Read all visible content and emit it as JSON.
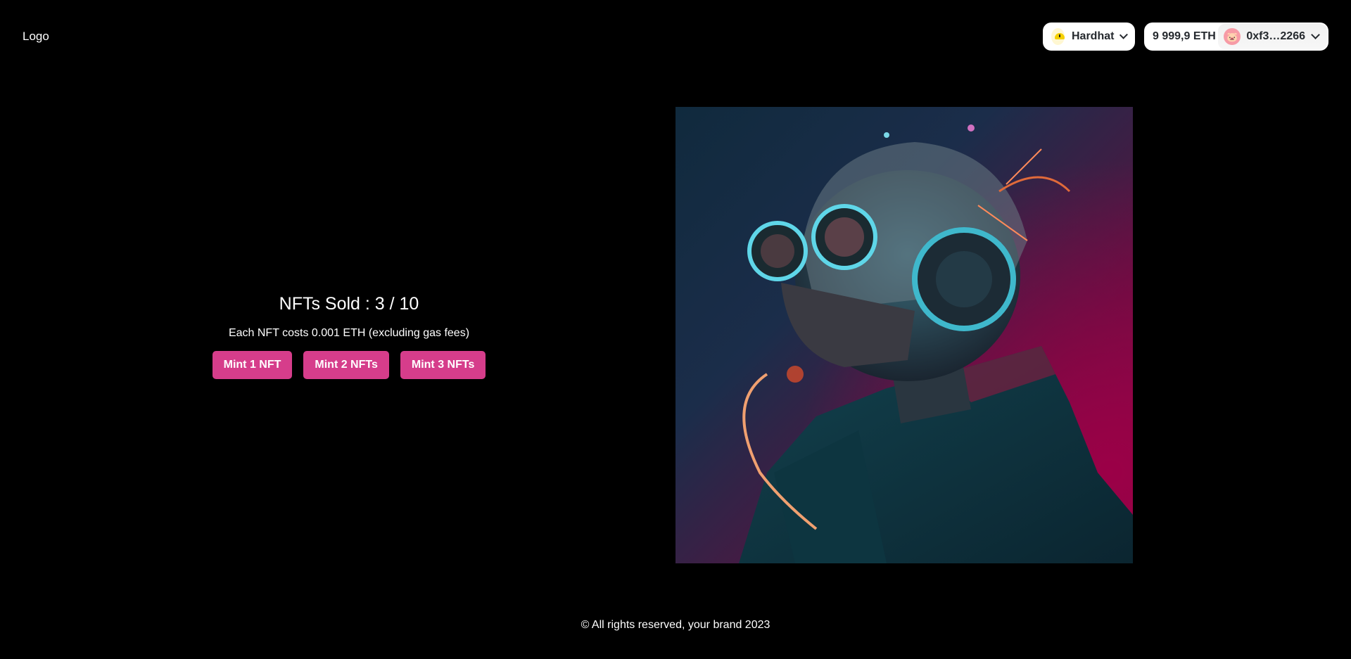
{
  "header": {
    "logo": "Logo",
    "chain": {
      "name": "Hardhat",
      "icon": "hardhat-icon"
    },
    "account": {
      "balance": "9 999,9 ETH",
      "address": "0xf3…2266",
      "avatar": "🐷"
    }
  },
  "mint": {
    "sold_text": "NFTs Sold : 3 / 10",
    "price_text": "Each NFT costs 0.001 ETH (excluding gas fees)",
    "buttons": [
      "Mint 1 NFT",
      "Mint 2 NFTs",
      "Mint 3 NFTs"
    ],
    "button_color": "#d63d8b"
  },
  "footer": {
    "text": "© All rights reserved, your brand 2023"
  }
}
